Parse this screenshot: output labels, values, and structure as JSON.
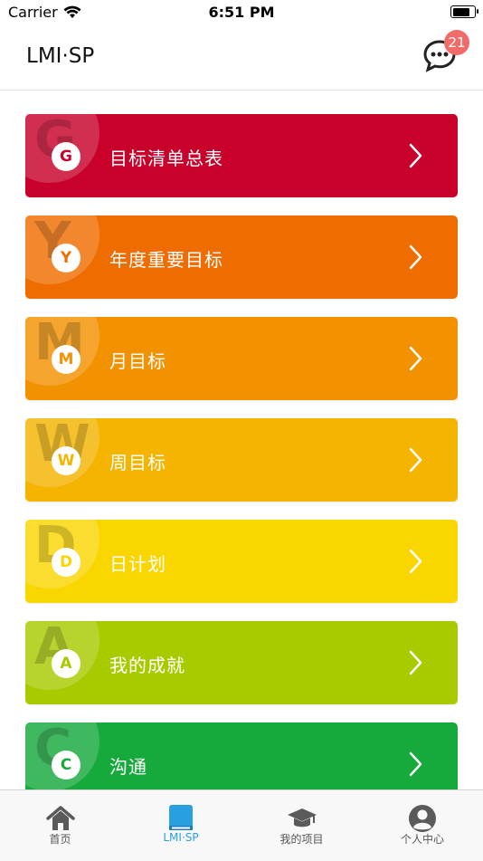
{
  "status_bar": {
    "carrier": "Carrier",
    "time": "6:51 PM",
    "battery_level": 0.9
  },
  "nav": {
    "title": "LMI·SP",
    "message_badge": "21"
  },
  "menu": [
    {
      "letter": "G",
      "label": "目标清单总表",
      "color": "#c8002a"
    },
    {
      "letter": "Y",
      "label": "年度重要目标",
      "color": "#ef6d00"
    },
    {
      "letter": "M",
      "label": "月目标",
      "color": "#f39200"
    },
    {
      "letter": "W",
      "label": "周目标",
      "color": "#f4b400"
    },
    {
      "letter": "D",
      "label": "日计划",
      "color": "#f9d600"
    },
    {
      "letter": "A",
      "label": "我的成就",
      "color": "#a8cb00"
    },
    {
      "letter": "C",
      "label": "沟通",
      "color": "#16a93c"
    }
  ],
  "tabs": [
    {
      "label": "首页",
      "icon": "home-icon",
      "active": false
    },
    {
      "label": "LMI·SP",
      "icon": "book-icon",
      "active": true
    },
    {
      "label": "我的项目",
      "icon": "graduation-cap-icon",
      "active": false
    },
    {
      "label": "个人中心",
      "icon": "user-icon",
      "active": false
    }
  ],
  "colors": {
    "tab_active": "#2a9fe0",
    "tab_inactive": "#555555",
    "badge": "#f26b6b"
  }
}
